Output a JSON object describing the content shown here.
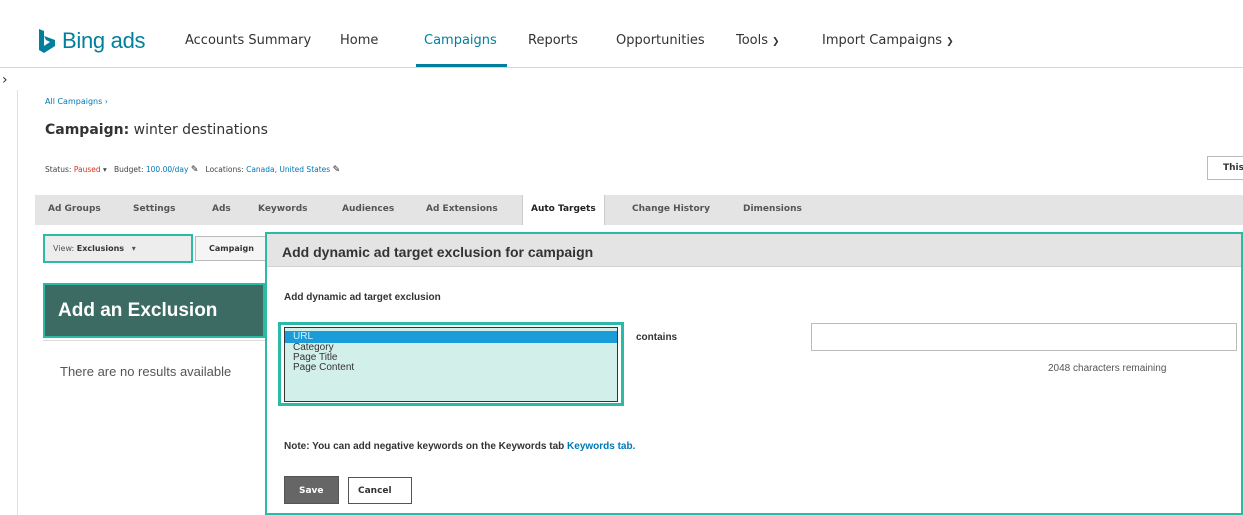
{
  "brand": {
    "name": "Bing ads",
    "color": "#00809d"
  },
  "nav": {
    "items": [
      {
        "label": "Accounts Summary"
      },
      {
        "label": "Home"
      },
      {
        "label": "Campaigns"
      },
      {
        "label": "Reports"
      },
      {
        "label": "Opportunities"
      },
      {
        "label": "Tools"
      },
      {
        "label": "Import Campaigns"
      }
    ],
    "active": "Campaigns"
  },
  "breadcrumb": "All Campaigns ›",
  "campaign": {
    "prefix": "Campaign:",
    "name": "winter destinations"
  },
  "status_line": {
    "status_label": "Status:",
    "status_value": "Paused",
    "budget_label": "Budget:",
    "budget_value": "100.00/day",
    "locations_label": "Locations:",
    "locations_value": "Canada, United States"
  },
  "right_button": "This",
  "tabs": [
    {
      "label": "Ad Groups"
    },
    {
      "label": "Settings"
    },
    {
      "label": "Ads"
    },
    {
      "label": "Keywords"
    },
    {
      "label": "Audiences"
    },
    {
      "label": "Ad Extensions"
    },
    {
      "label": "Auto Targets",
      "active": true
    },
    {
      "label": "Change History"
    },
    {
      "label": "Dimensions"
    }
  ],
  "view": {
    "prefix": "View:",
    "value": "Exclusions"
  },
  "campaign_button": "Campaign",
  "add_exclusion": "Add an Exclusion",
  "no_results": "There are no results available",
  "modal": {
    "title": "Add dynamic ad target exclusion for campaign",
    "subtitle": "Add dynamic ad target exclusion",
    "select_options": [
      "URL",
      "Category",
      "Page Title",
      "Page Content"
    ],
    "selected_option": "URL",
    "operator": "contains",
    "input_value": "",
    "chars_remaining": "2048 characters remaining",
    "note_text": "Note: You can add negative keywords on the Keywords tab",
    "note_link": "Keywords tab.",
    "save_label": "Save",
    "cancel_label": "Cancel"
  },
  "colors": {
    "accent": "#2bbaa3",
    "link": "#0078b4",
    "paused": "#d4341f",
    "selection": "#1a9cd8"
  }
}
